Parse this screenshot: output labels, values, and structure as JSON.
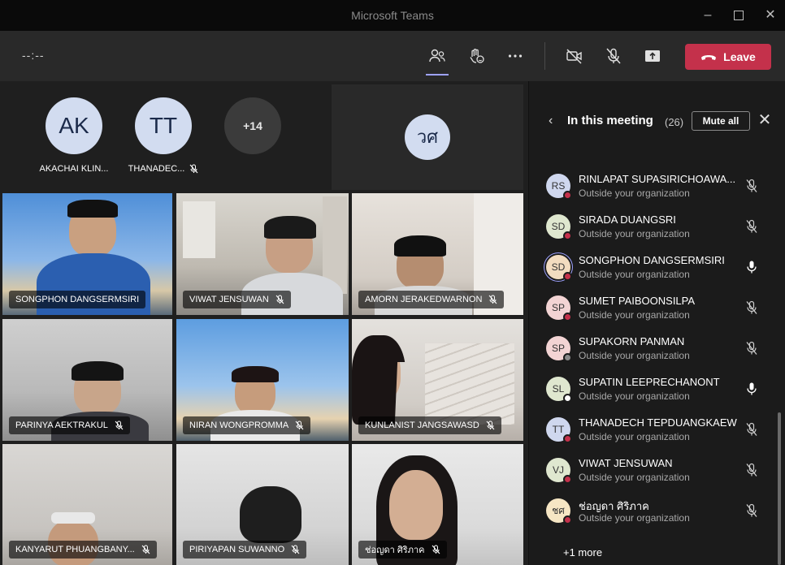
{
  "window": {
    "title": "Microsoft Teams"
  },
  "toolbar": {
    "timer": "--:--",
    "leave_label": "Leave"
  },
  "stage": {
    "top_avatars": [
      {
        "initials": "AK",
        "name": "AKACHAI KLIN...",
        "muted": false
      },
      {
        "initials": "TT",
        "name": "THANADEC...",
        "muted": true
      },
      {
        "initials": "+14",
        "name": "",
        "muted": false
      }
    ],
    "shared_avatar": {
      "initials": "วศ"
    },
    "video_tiles": [
      {
        "name": "SONGPHON DANGSERMSIRI",
        "muted": false,
        "speaking": true
      },
      {
        "name": "VIWAT JENSUWAN",
        "muted": true,
        "speaking": false
      },
      {
        "name": "AMORN JERAKEDWARNON",
        "muted": true,
        "speaking": false
      },
      {
        "name": "PARINYA AEKTRAKUL",
        "muted": true,
        "speaking": false
      },
      {
        "name": "NIRAN WONGPROMMA",
        "muted": true,
        "speaking": false
      },
      {
        "name": "KUNLANIST JANGSAWASD",
        "muted": true,
        "speaking": false
      },
      {
        "name": "KANYARUT PHUANGBANY...",
        "muted": true,
        "speaking": false
      },
      {
        "name": "PIRIYAPAN SUWANNO",
        "muted": true,
        "speaking": false
      },
      {
        "name": "ช่อญดา ศิริภาค",
        "muted": true,
        "speaking": false
      }
    ]
  },
  "panel": {
    "title": "In this meeting",
    "count": "(26)",
    "mute_all_label": "Mute all",
    "more_label": "+1 more",
    "participants": [
      {
        "initials": "RS",
        "name": "RINLAPAT SUPASIRICHOAWA...",
        "org": "Outside your organization",
        "muted": true,
        "status": "red",
        "avatar_color": "#cfd7ee"
      },
      {
        "initials": "SD",
        "name": "SIRADA DUANGSRI",
        "org": "Outside your organization",
        "muted": true,
        "status": "red",
        "avatar_color": "#dfe7cf"
      },
      {
        "initials": "SD",
        "name": "SONGPHON DANGSERMSIRI",
        "org": "Outside your organization",
        "muted": false,
        "status": "red",
        "avatar_color": "#f2dcc0",
        "selected": true
      },
      {
        "initials": "SP",
        "name": "SUMET PAIBOONSILPA",
        "org": "Outside your organization",
        "muted": true,
        "status": "red",
        "avatar_color": "#f3d4d4"
      },
      {
        "initials": "SP",
        "name": "SUPAKORN PANMAN",
        "org": "Outside your organization",
        "muted": true,
        "status": "grey",
        "avatar_color": "#f3d4d4"
      },
      {
        "initials": "SL",
        "name": "SUPATIN LEEPRECHANONT",
        "org": "Outside your organization",
        "muted": false,
        "status": "ring",
        "avatar_color": "#dfe7cf"
      },
      {
        "initials": "TT",
        "name": "THANADECH TEPDUANGKAEW",
        "org": "Outside your organization",
        "muted": true,
        "status": "red",
        "avatar_color": "#cfd7ee"
      },
      {
        "initials": "VJ",
        "name": "VIWAT JENSUWAN",
        "org": "Outside your organization",
        "muted": true,
        "status": "red",
        "avatar_color": "#dfe7cf"
      },
      {
        "initials": "ชศ",
        "name": "ช่อญดา ศิริภาค",
        "org": "Outside your organization",
        "muted": true,
        "status": "red",
        "avatar_color": "#f6e6c4"
      }
    ]
  },
  "colors": {
    "accent": "#9ea2ff",
    "leave": "#c4314b"
  }
}
